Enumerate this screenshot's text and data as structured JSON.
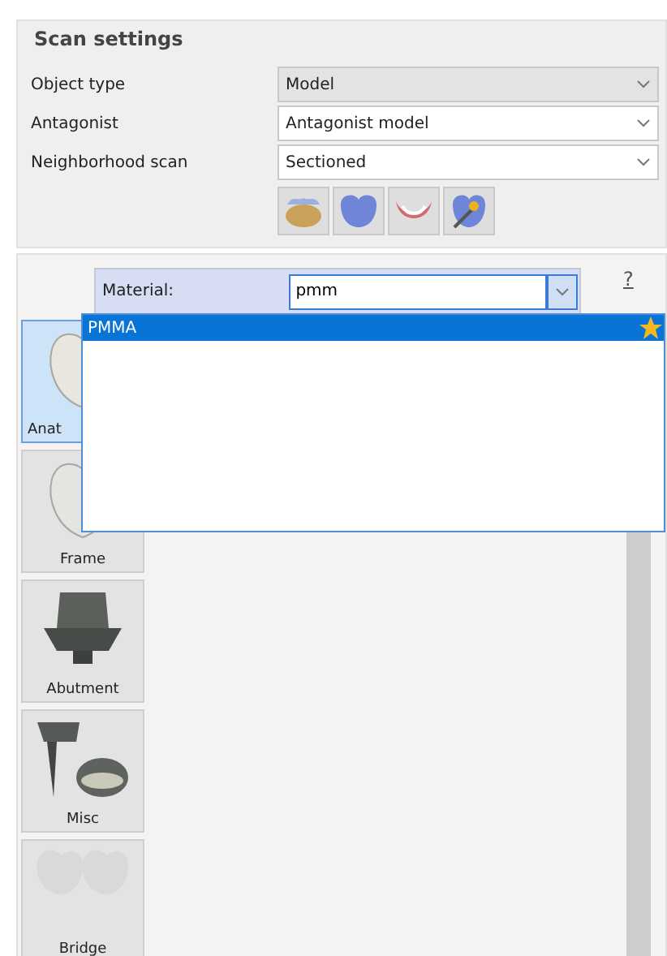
{
  "scan_settings": {
    "title": "Scan settings",
    "fields": [
      {
        "label": "Object type",
        "value": "Model",
        "disabled": true
      },
      {
        "label": "Antagonist",
        "value": "Antagonist model",
        "disabled": false
      },
      {
        "label": "Neighborhood scan",
        "value": "Sectioned",
        "disabled": false
      }
    ],
    "scan_buttons": [
      {
        "kind": "crown"
      },
      {
        "kind": "tooth"
      },
      {
        "kind": "gum"
      },
      {
        "kind": "wand"
      }
    ]
  },
  "material": {
    "label": "Material:",
    "value": "pmm",
    "help": "?",
    "options": [
      {
        "label": "PMMA",
        "selected": true,
        "favorite": true
      }
    ]
  },
  "tools": [
    {
      "label": "Anat",
      "kind": "anatomy",
      "selected": true,
      "covered": true
    },
    {
      "label": "Frame",
      "kind": "frame",
      "selected": false
    },
    {
      "label": "Abutment",
      "kind": "abutment",
      "selected": false
    },
    {
      "label": "Misc",
      "kind": "misc",
      "selected": false
    },
    {
      "label": "Bridge",
      "kind": "bridge",
      "selected": false
    }
  ]
}
